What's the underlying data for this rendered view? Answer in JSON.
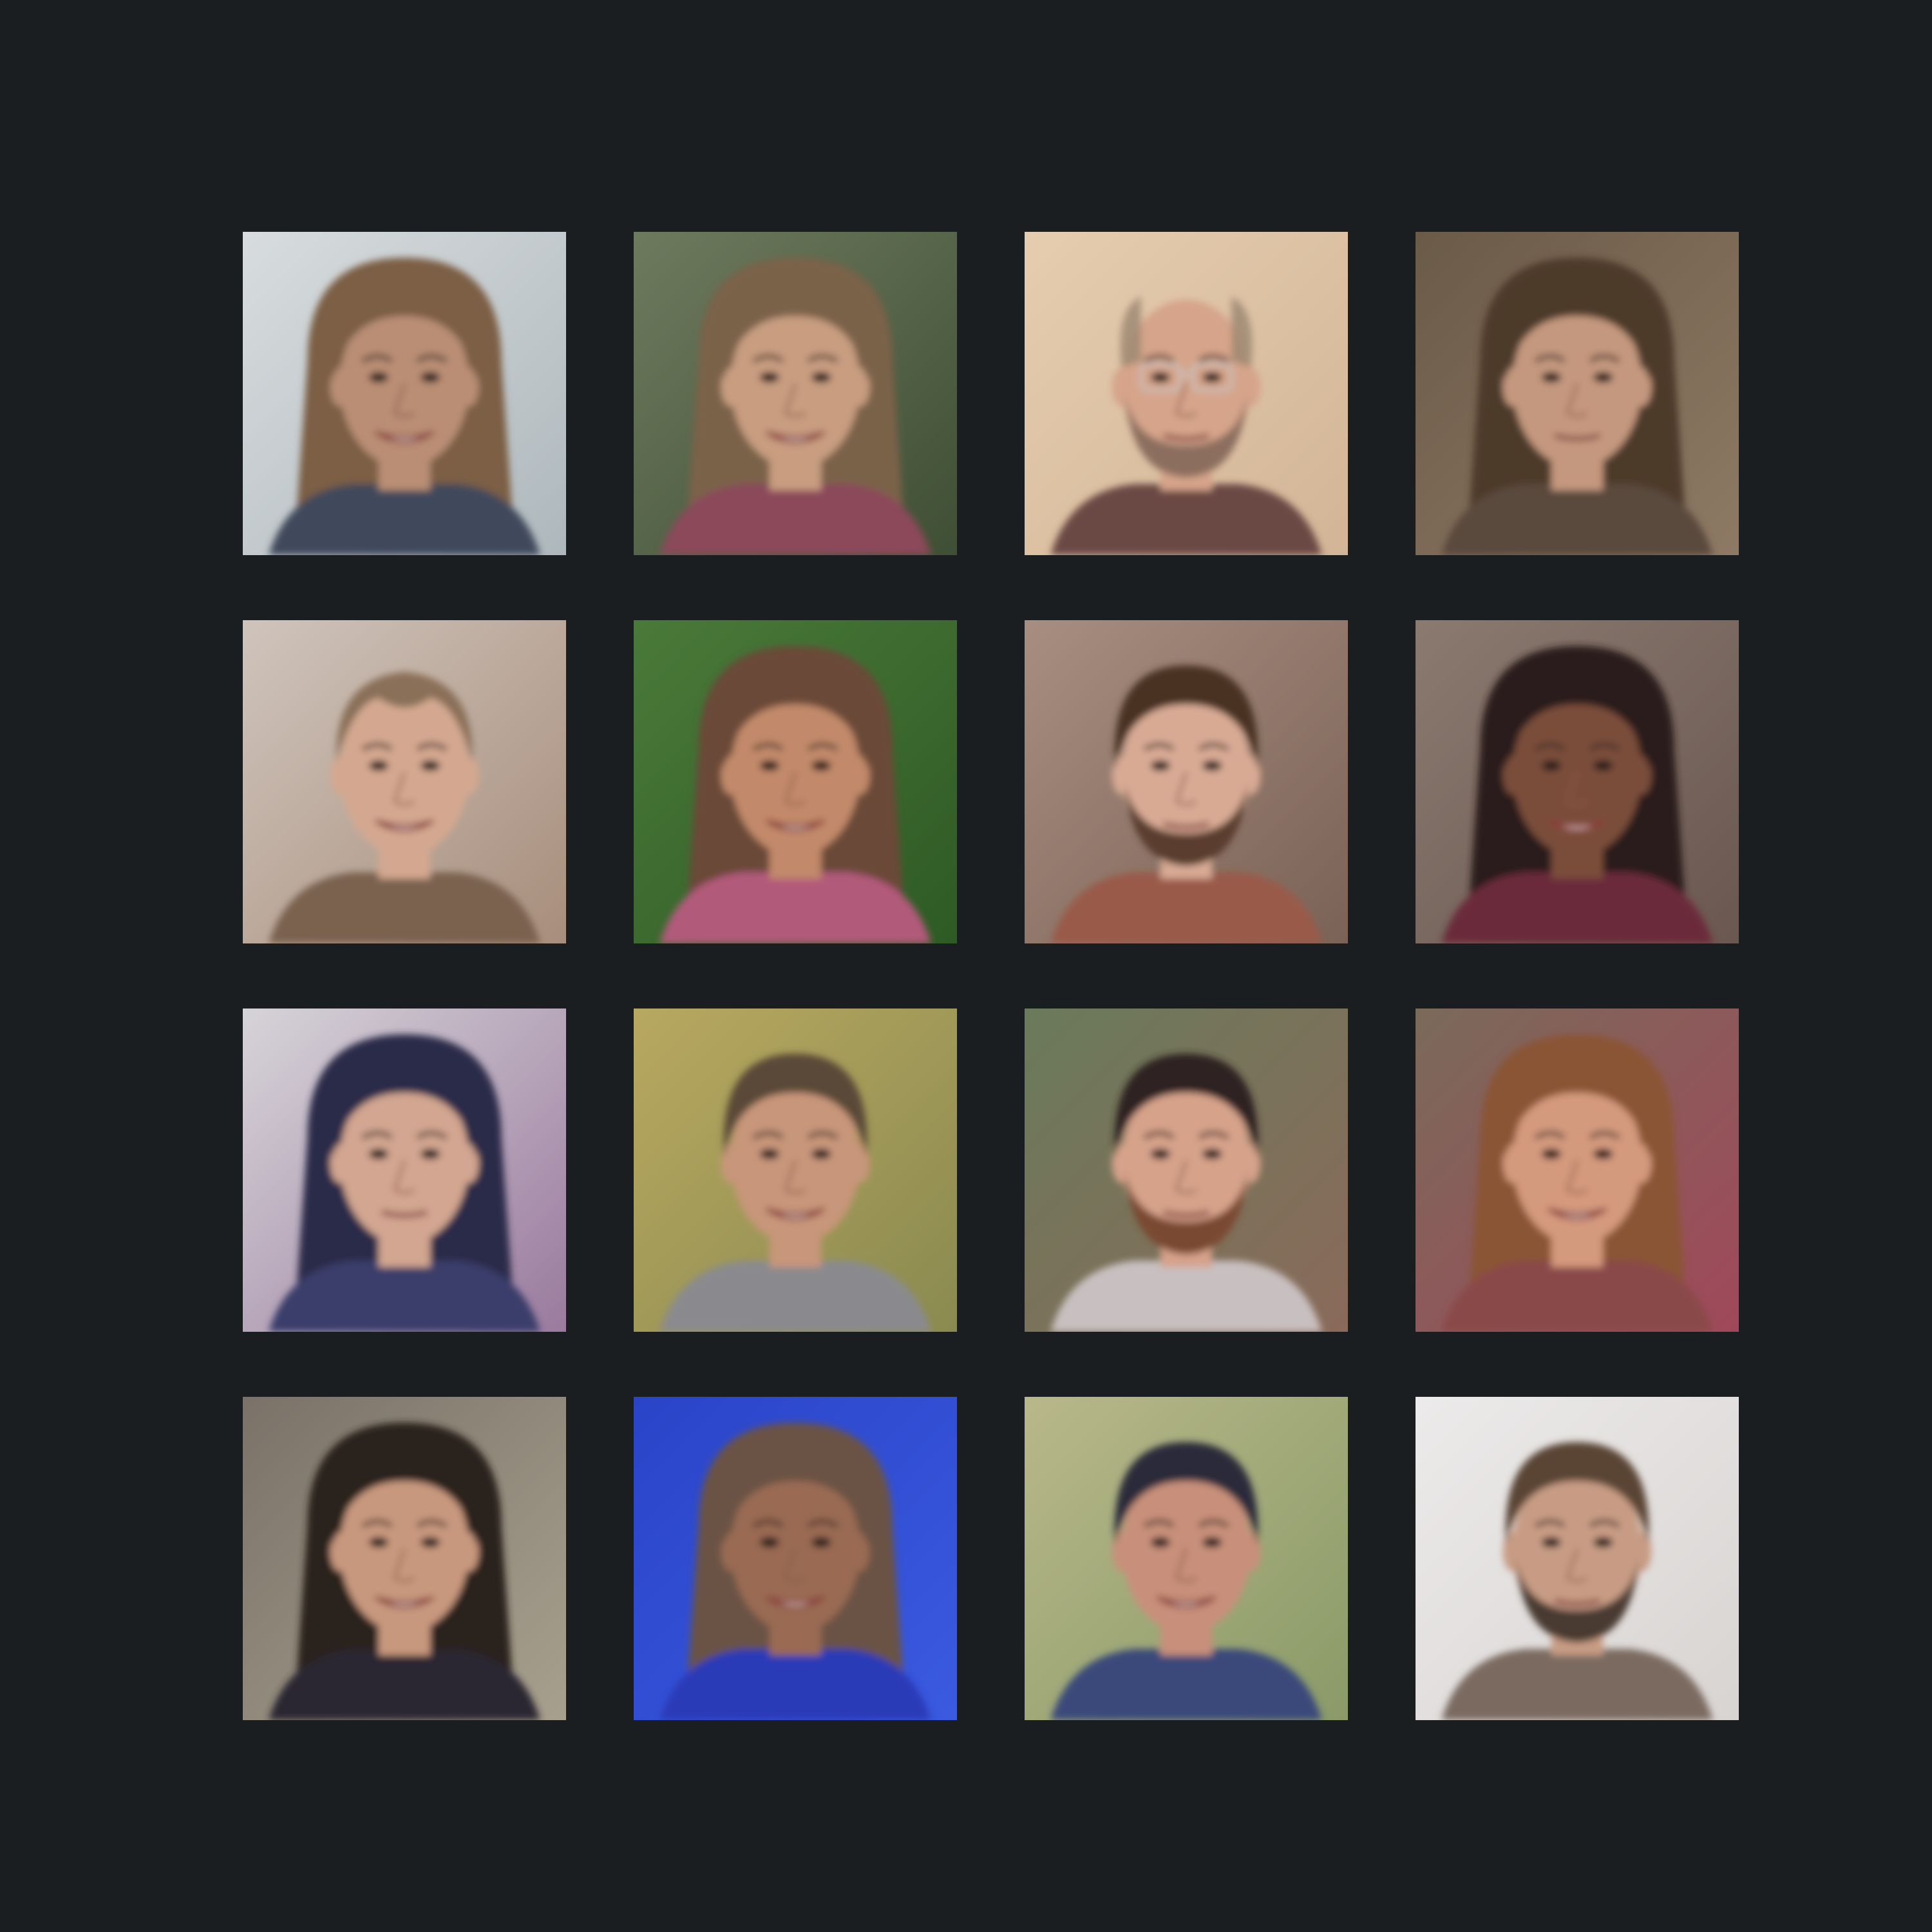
{
  "background_color": "#1b1e20",
  "faces": [
    {
      "bg": "#d8dcde",
      "bg2": "#aeb8bc",
      "skin": "#b98e74",
      "hair": "#7b5e44",
      "hair_style": "long",
      "shirt": "#3f4a5c",
      "beard": null,
      "glasses": false,
      "smile": true
    },
    {
      "bg": "#6e7a5e",
      "bg2": "#3f4f34",
      "skin": "#c89d80",
      "hair": "#7a6248",
      "hair_style": "long",
      "shirt": "#8b4a5a",
      "beard": null,
      "glasses": false,
      "smile": true
    },
    {
      "bg": "#e6cdb0",
      "bg2": "#d2b596",
      "skin": "#d6a48a",
      "hair": "#9a8670",
      "hair_style": "bald",
      "shirt": "#6b4a44",
      "beard": "#8c6e5e",
      "glasses": true,
      "smile": false
    },
    {
      "bg": "#6a5a48",
      "bg2": "#8e7a64",
      "skin": "#c4987e",
      "hair": "#4e3a2a",
      "hair_style": "curly",
      "shirt": "#5a4a3c",
      "beard": null,
      "glasses": false,
      "smile": false
    },
    {
      "bg": "#cfc4bc",
      "bg2": "#a88e7c",
      "skin": "#d4a890",
      "hair": "#8a7058",
      "hair_style": "receding",
      "shirt": "#7a6250",
      "beard": null,
      "glasses": false,
      "smile": true
    },
    {
      "bg": "#4a7a3a",
      "bg2": "#2e5a24",
      "skin": "#c28a6a",
      "hair": "#6a4838",
      "hair_style": "long",
      "shirt": "#b25a7a",
      "beard": null,
      "glasses": false,
      "smile": true
    },
    {
      "bg": "#a88e80",
      "bg2": "#7a6256",
      "skin": "#d8aa94",
      "hair": "#4a3224",
      "hair_style": "short",
      "shirt": "#9a5a4a",
      "beard": "#5a3e2e",
      "glasses": false,
      "smile": false
    },
    {
      "bg": "#8a7a70",
      "bg2": "#6a5850",
      "skin": "#7a4e3a",
      "hair": "#2a1e1a",
      "hair_style": "curly",
      "shirt": "#6a2a3a",
      "beard": null,
      "glasses": false,
      "smile": true
    },
    {
      "bg": "#d6d4d8",
      "bg2": "#9a7a9e",
      "skin": "#d2a690",
      "hair": "#2a2a4a",
      "hair_style": "long",
      "shirt": "#3a3e6a",
      "beard": null,
      "glasses": false,
      "smile": false
    },
    {
      "bg": "#b8a860",
      "bg2": "#8a8a50",
      "skin": "#c8967a",
      "hair": "#5a4838",
      "hair_style": "short",
      "shirt": "#8a8a8e",
      "beard": null,
      "glasses": false,
      "smile": true
    },
    {
      "bg": "#6a7a5a",
      "bg2": "#8a6a5a",
      "skin": "#d6a28a",
      "hair": "#2e2420",
      "hair_style": "short",
      "shirt": "#c8c0c0",
      "beard": "#7a4a30",
      "glasses": false,
      "smile": false
    },
    {
      "bg": "#7a6a5a",
      "bg2": "#a0485a",
      "skin": "#d49a7e",
      "hair": "#8a5436",
      "hair_style": "long",
      "shirt": "#8a4a4a",
      "beard": null,
      "glasses": false,
      "smile": true
    },
    {
      "bg": "#7a7268",
      "bg2": "#a8a08e",
      "skin": "#c8987e",
      "hair": "#2a201c",
      "hair_style": "long",
      "shirt": "#2a2830",
      "beard": null,
      "glasses": false,
      "smile": true
    },
    {
      "bg": "#2a44c8",
      "bg2": "#3a5ae0",
      "skin": "#9a6a52",
      "hair": "#6a5244",
      "hair_style": "long",
      "shirt": "#2a3ab8",
      "beard": null,
      "glasses": false,
      "smile": true
    },
    {
      "bg": "#b8b88a",
      "bg2": "#8a9a68",
      "skin": "#c8907a",
      "hair": "#2a2c3a",
      "hair_style": "short",
      "shirt": "#3a4a7a",
      "beard": null,
      "glasses": false,
      "smile": true
    },
    {
      "bg": "#eceaea",
      "bg2": "#d8d4d2",
      "skin": "#c89c84",
      "hair": "#5a4434",
      "hair_style": "short",
      "shirt": "#7a6a60",
      "beard": "#4a3a30",
      "glasses": false,
      "smile": false
    }
  ]
}
